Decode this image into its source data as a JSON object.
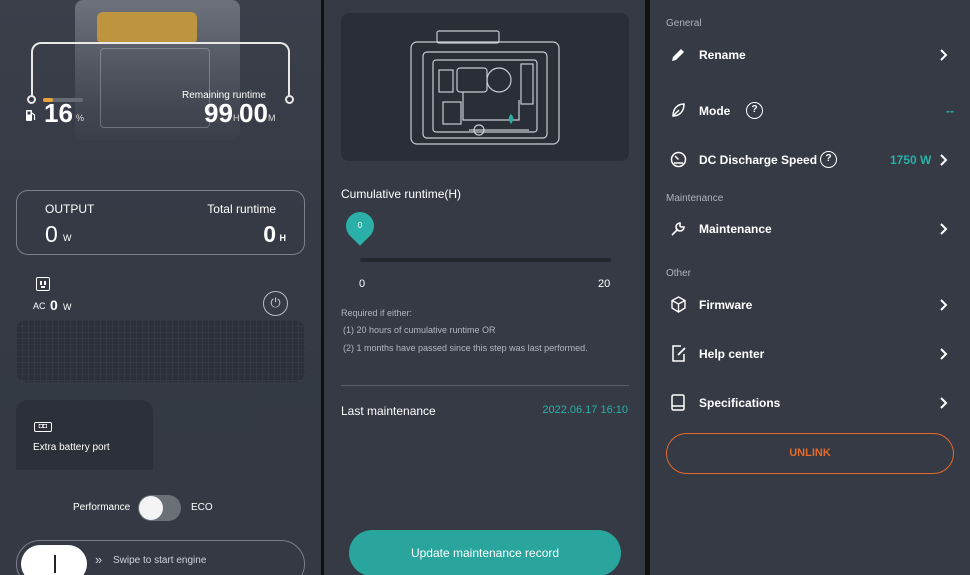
{
  "panel_left": {
    "fuel": {
      "percent": "16",
      "unit": "%",
      "level": 0.16
    },
    "remaining": {
      "label": "Remaining runtime",
      "hours": "99",
      "h_unit": "H",
      "minutes": "00",
      "m_unit": "M"
    },
    "output_card": {
      "output_label": "OUTPUT",
      "output_value": "0",
      "output_unit": "W",
      "runtime_label": "Total runtime",
      "runtime_value": "0",
      "runtime_unit": "H"
    },
    "ac": {
      "label": "AC",
      "value": "0",
      "unit": "W"
    },
    "extra_battery": {
      "icon_text": "◘◘",
      "label": "Extra battery port"
    },
    "mode_toggle": {
      "left": "Performance",
      "right": "ECO"
    },
    "swipe": {
      "label": "Swipe to start engine",
      "arrows": "»"
    }
  },
  "panel_middle": {
    "cumulative_label": "Cumulative runtime(H)",
    "slider": {
      "value": "0",
      "min": "0",
      "max": "20"
    },
    "requirements": {
      "heading": "Required if either:",
      "line1": "(1) 20 hours of cumulative runtime OR",
      "line2": "(2) 1 months have passed since this step was last performed."
    },
    "last_maintenance": {
      "label": "Last maintenance",
      "value": "2022.06.17 16:10"
    },
    "update_button": "Update maintenance record"
  },
  "panel_right": {
    "section_general": "General",
    "rename": "Rename",
    "mode": {
      "label": "Mode",
      "value": "--"
    },
    "dc_speed": {
      "label": "DC Discharge Speed",
      "value": "1750 W"
    },
    "section_maintenance": "Maintenance",
    "maintenance": "Maintenance",
    "section_other": "Other",
    "firmware": "Firmware",
    "help_center": "Help center",
    "specifications": "Specifications",
    "unlink": "UNLINK"
  },
  "colors": {
    "teal": "#29a59d",
    "orange": "#e36a2c",
    "amber": "#e8a33b",
    "panel": "#353a45"
  }
}
